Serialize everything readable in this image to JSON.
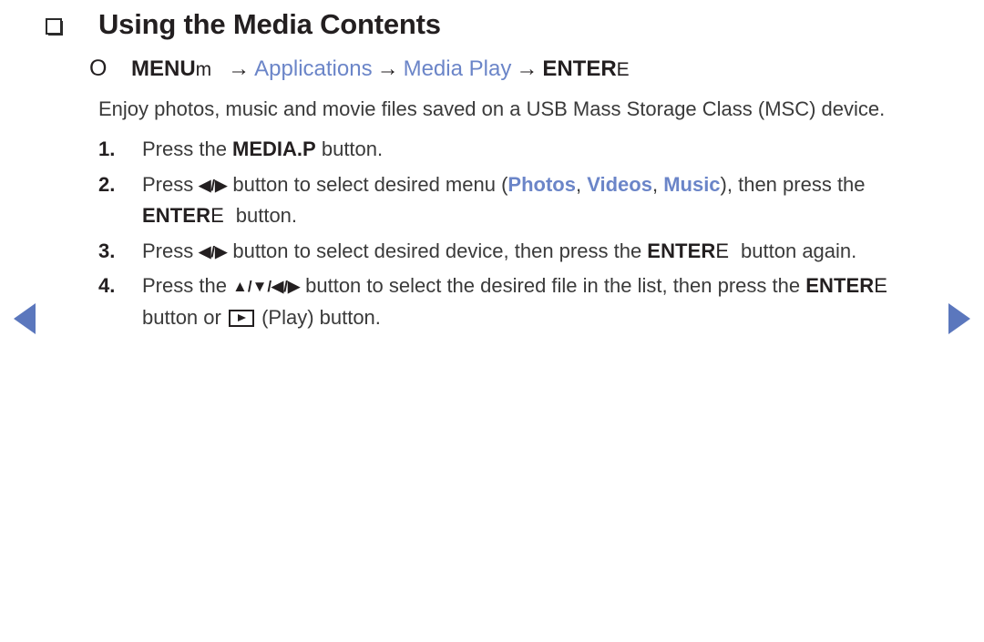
{
  "page": {
    "title": "Using the Media Contents",
    "title_bullet_icon": "square-3d-bullet-icon"
  },
  "menu_path": {
    "bullet_icon": "circle-o-bullet-icon",
    "menu_label": "MENU",
    "menu_key_symbol": "m",
    "arrow": "→",
    "step1": "Applications",
    "step2": "Media Play",
    "enter_label": "ENTER",
    "enter_key_symbol": "E"
  },
  "intro": {
    "text": "Enjoy photos, music and movie files saved on a USB Mass Storage Class (MSC) device."
  },
  "steps": [
    {
      "number": "1.",
      "pre": "Press the ",
      "bold": "MEDIA.P",
      "post": " button."
    },
    {
      "number": "2.",
      "pre": "Press ",
      "dirkeys": "◀/▶",
      "mid": " button to select desired menu (",
      "option1": "Photos",
      "sep1": ", ",
      "option2": "Videos",
      "sep2": ", ",
      "option3": "Music",
      "post": "), then press the ",
      "enter_label": "ENTER",
      "enter_key_symbol": "E",
      "tail": "button."
    },
    {
      "number": "3.",
      "pre": "Press ",
      "dirkeys": "◀/▶",
      "mid": " button to select desired device, then press the ",
      "enter_label": "ENTER",
      "enter_key_symbol": "E",
      "tail": "button again."
    },
    {
      "number": "4.",
      "pre": "Press the ",
      "dirkeys": "▲/▼/◀/▶",
      "mid": " button to select the desired file in the list, then press the ",
      "enter_label": "ENTER",
      "enter_key_symbol": "E",
      "tail": "button or ",
      "play_icon": "play-button-icon",
      "tail2": " (Play) button."
    }
  ],
  "navigation": {
    "prev_icon": "prev-page-arrow-icon",
    "next_icon": "next-page-arrow-icon"
  },
  "colors": {
    "accent_blue": "#6b85c8",
    "nav_arrow_blue": "#5b77bd",
    "text_dark": "#231f20",
    "body_text": "#3a3a3a",
    "background": "#ffffff"
  }
}
